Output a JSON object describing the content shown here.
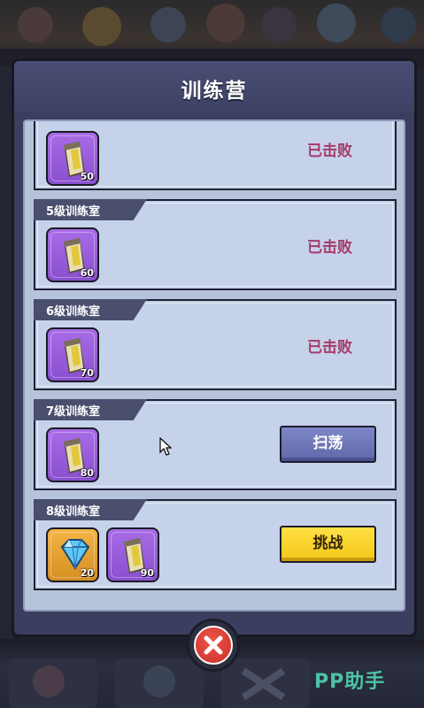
{
  "dialog": {
    "title": "训练营"
  },
  "rooms": [
    {
      "label": "",
      "rewards": [
        {
          "type": "scroll",
          "icon": "scroll-icon",
          "count": "50",
          "color": "purple"
        }
      ],
      "status": "已击败",
      "action": null
    },
    {
      "label": "5级训练室",
      "rewards": [
        {
          "type": "scroll",
          "icon": "scroll-icon",
          "count": "60",
          "color": "purple"
        }
      ],
      "status": "已击败",
      "action": null
    },
    {
      "label": "6级训练室",
      "rewards": [
        {
          "type": "scroll",
          "icon": "scroll-icon",
          "count": "70",
          "color": "purple"
        }
      ],
      "status": "已击败",
      "action": null
    },
    {
      "label": "7级训练室",
      "rewards": [
        {
          "type": "scroll",
          "icon": "scroll-icon",
          "count": "80",
          "color": "purple"
        }
      ],
      "status": "",
      "action": {
        "label": "扫荡",
        "style": "sweep"
      }
    },
    {
      "label": "8级训练室",
      "rewards": [
        {
          "type": "gem",
          "icon": "diamond-icon",
          "count": "20",
          "color": "gold"
        },
        {
          "type": "scroll",
          "icon": "scroll-icon",
          "count": "90",
          "color": "purple"
        }
      ],
      "status": "",
      "action": {
        "label": "挑战",
        "style": "challenge"
      }
    }
  ],
  "watermark": "PP助手",
  "colors": {
    "panel": "#3b3e5e",
    "card": "#c6d2e9",
    "defeated_text": "#a53b6b",
    "sweep_button": "#6f78b8",
    "challenge_button": "#f6d02a",
    "close_button": "#d63c32",
    "watermark": "#4cc3a8"
  }
}
